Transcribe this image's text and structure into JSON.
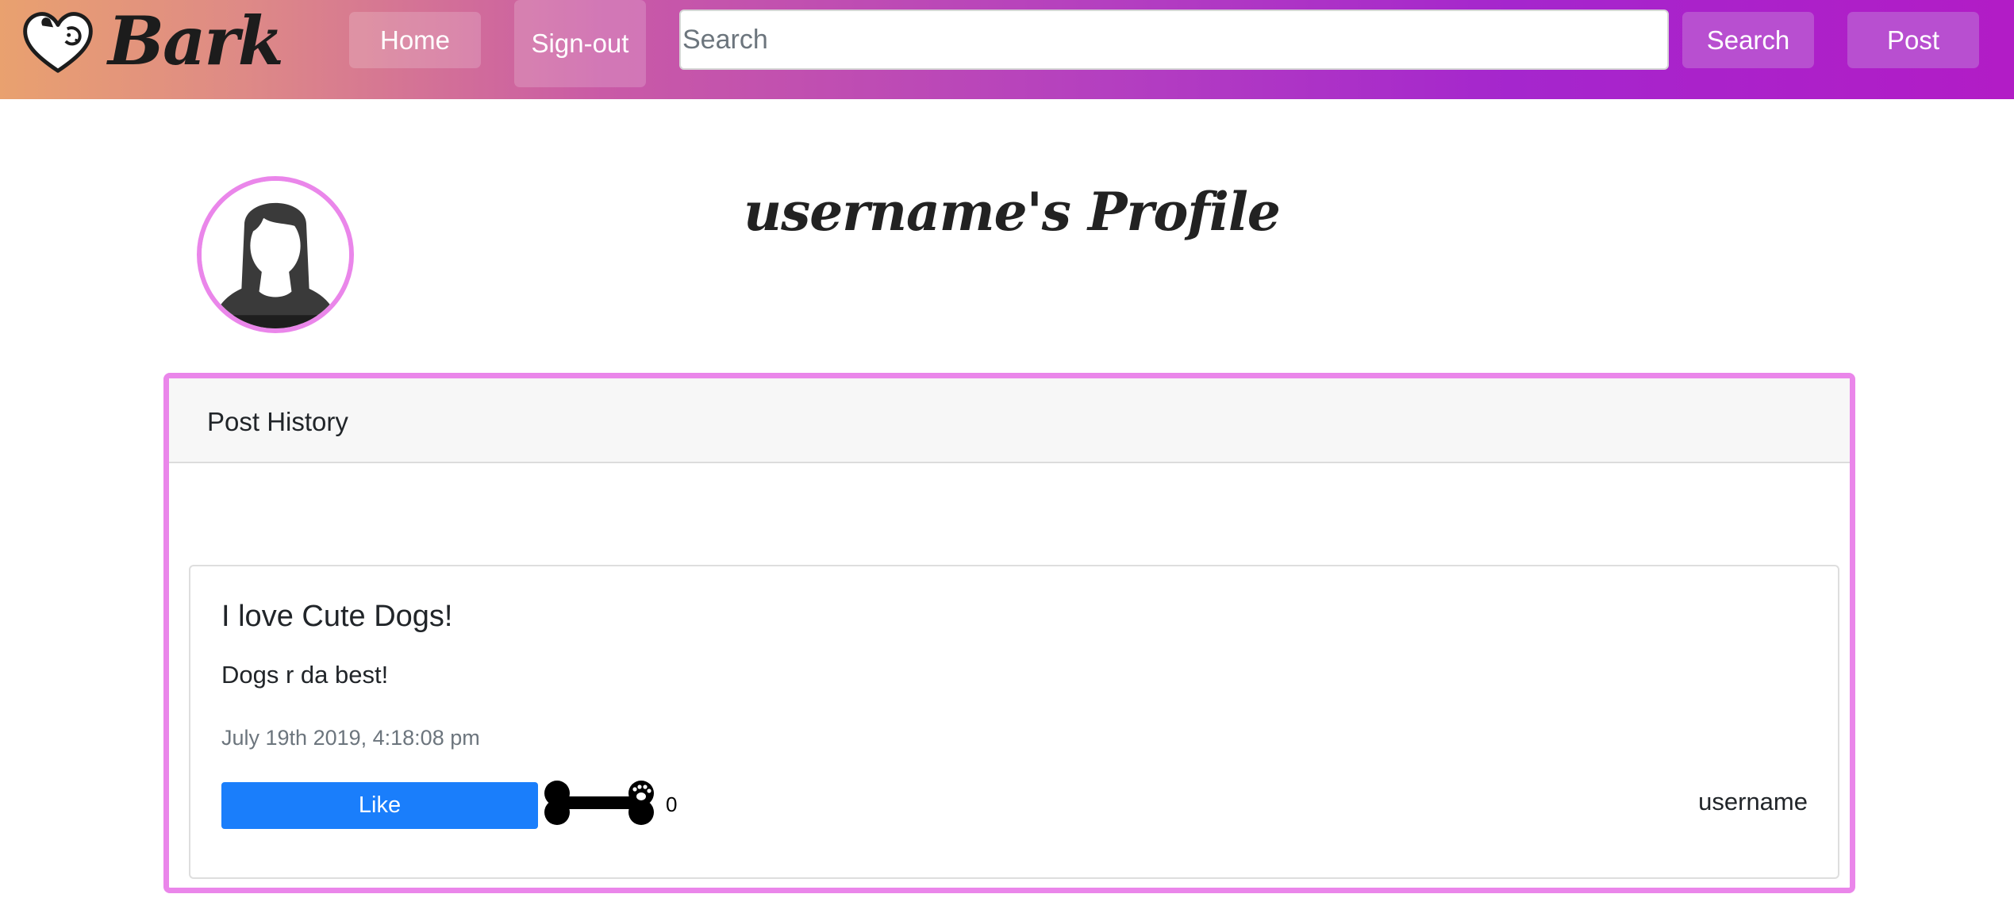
{
  "navbar": {
    "brand": "Bark",
    "logo_icon": "dog-heart-logo-icon",
    "home_label": "Home",
    "signout_label": "Sign-out",
    "search_placeholder": "Search",
    "search_value": "",
    "search_button_label": "Search",
    "post_button_label": "Post",
    "gradient_colors": [
      "#e9a16f",
      "#c95aa6",
      "#a526cd"
    ],
    "button_color": "#b84fd0"
  },
  "profile": {
    "title": "username's Profile",
    "avatar_icon": "female-avatar-icon",
    "accent_color": "#ea86ea"
  },
  "post_history": {
    "heading": "Post History",
    "posts": [
      {
        "title": "I love Cute Dogs!",
        "body": "Dogs r da best!",
        "timestamp": "July 19th 2019, 4:18:08 pm",
        "like_label": "Like",
        "like_icon": "dog-bone-icon",
        "like_count": "0",
        "author": "username"
      }
    ]
  }
}
